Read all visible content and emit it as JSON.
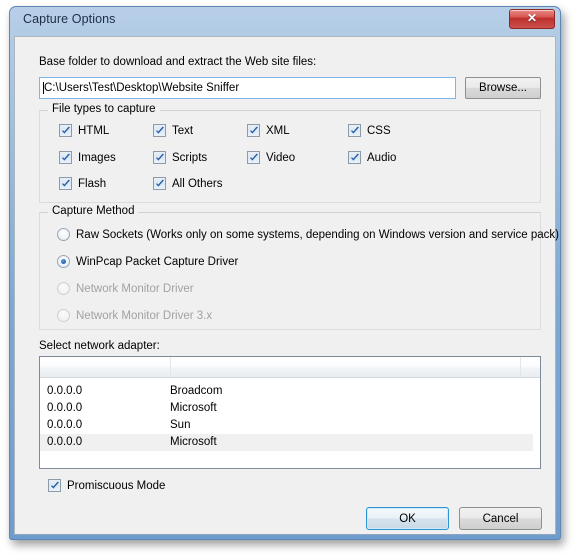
{
  "window": {
    "title": "Capture Options",
    "close_label": "✕",
    "close_icon": "close-icon"
  },
  "base_folder": {
    "label": "Base folder to download and extract the Web site files:",
    "value": "C:\\Users\\Test\\Desktop\\Website Sniffer",
    "placeholder": "",
    "browse_label": "Browse..."
  },
  "file_types": {
    "title": "File types to capture",
    "items": [
      {
        "label": "HTML",
        "checked": true
      },
      {
        "label": "Text",
        "checked": true
      },
      {
        "label": "XML",
        "checked": true
      },
      {
        "label": "CSS",
        "checked": true
      },
      {
        "label": "Images",
        "checked": true
      },
      {
        "label": "Scripts",
        "checked": true
      },
      {
        "label": "Video",
        "checked": true
      },
      {
        "label": "Audio",
        "checked": true
      },
      {
        "label": "Flash",
        "checked": true
      },
      {
        "label": "All Others",
        "checked": true
      }
    ]
  },
  "capture_method": {
    "title": "Capture Method",
    "options": [
      {
        "label": "Raw Sockets  (Works only on some systems, depending on Windows version and service pack)",
        "selected": false,
        "enabled": true
      },
      {
        "label": "WinPcap Packet Capture Driver",
        "selected": true,
        "enabled": true
      },
      {
        "label": "Network Monitor Driver",
        "selected": false,
        "enabled": false
      },
      {
        "label": "Network Monitor Driver 3.x",
        "selected": false,
        "enabled": false
      }
    ]
  },
  "adapter_list": {
    "label": "Select network adapter:",
    "columns": [
      "",
      "",
      ""
    ],
    "rows": [
      {
        "ip": "0.0.0.0",
        "name": "Broadcom",
        "selected": false
      },
      {
        "ip": "0.0.0.0",
        "name": "Microsoft",
        "selected": false
      },
      {
        "ip": "0.0.0.0",
        "name": "Sun",
        "selected": false
      },
      {
        "ip": "0.0.0.0",
        "name": "Microsoft",
        "selected": true
      }
    ]
  },
  "promiscuous": {
    "label": "Promiscuous Mode",
    "checked": true
  },
  "buttons": {
    "ok_label": "OK",
    "cancel_label": "Cancel"
  },
  "colors": {
    "titlebar_blue": "#7fa9d4",
    "close_red": "#cf504b",
    "accent_focus": "#7eb4ea",
    "default_btn_border": "#2c94d4",
    "dialog_bg": "#f0f0f0",
    "selection_row": "#f0f0f0",
    "disabled_text": "#a2a2a2"
  }
}
